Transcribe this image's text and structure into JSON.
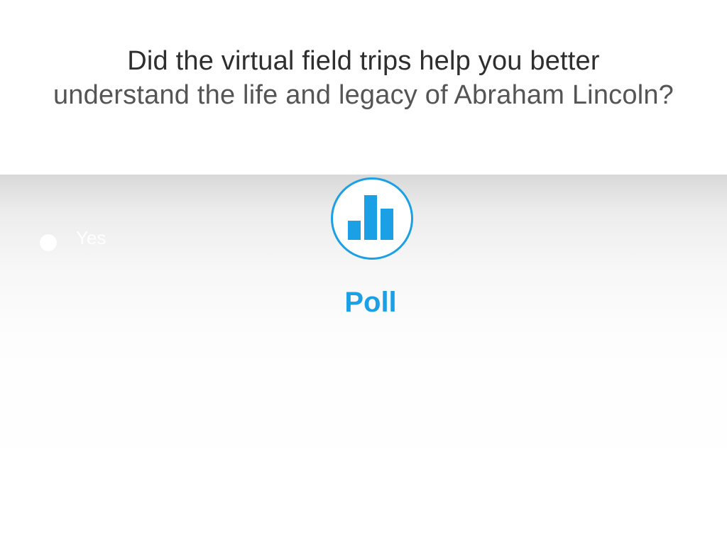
{
  "question": {
    "line1": "Did the virtual field trips help you better",
    "line2": "understand the life and legacy of Abraham Lincoln?"
  },
  "options": [
    {
      "label": "Yes"
    }
  ],
  "poll": {
    "label": "Poll",
    "icon": "bar-chart-icon"
  },
  "colors": {
    "accent": "#1ba0e6",
    "question_text": "#2e2e2e"
  }
}
